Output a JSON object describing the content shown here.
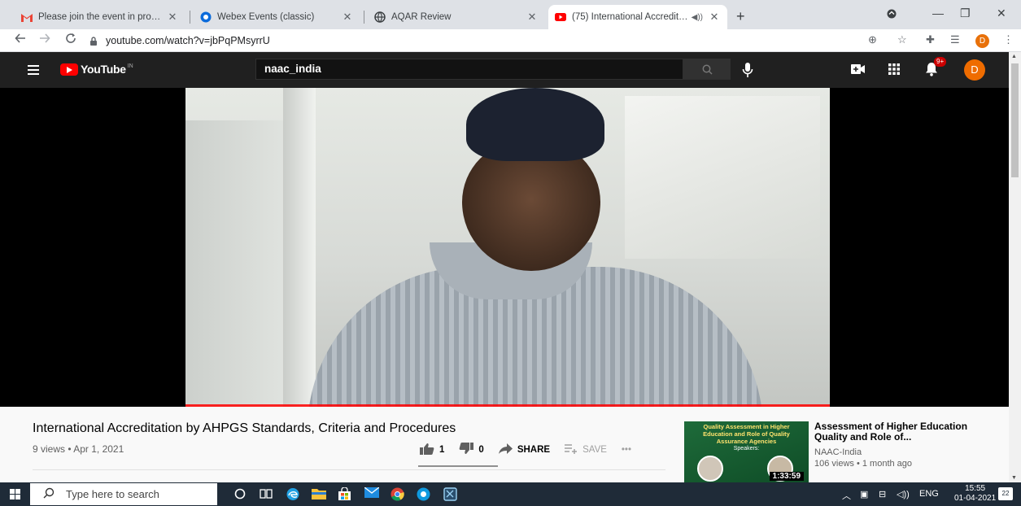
{
  "browser": {
    "tabs": [
      {
        "title": "Please join the event in progress",
        "favicon": "gmail-icon",
        "active": false
      },
      {
        "title": "Webex Events (classic)",
        "favicon": "webex-icon",
        "active": false
      },
      {
        "title": "AQAR Review",
        "favicon": "globe-icon",
        "active": false
      },
      {
        "title": "(75) International Accreditati",
        "favicon": "youtube-icon",
        "active": true
      }
    ],
    "tab_close": "✕",
    "new_tab": "+",
    "window_controls": [
      "—",
      "❐",
      "✕"
    ],
    "url": "youtube.com/watch?v=jbPqPMsyrrU",
    "profile_initial": "D"
  },
  "youtube": {
    "logo_text": "YouTube",
    "logo_country": "IN",
    "search_value": "naac_india",
    "notification_count": "9+",
    "avatar_initial": "D"
  },
  "video": {
    "title": "International Accreditation by AHPGS Standards, Criteria and Procedures",
    "meta": "9 views • Apr 1, 2021",
    "likes": "1",
    "dislikes": "0",
    "share_label": "SHARE",
    "save_label": "SAVE",
    "more_label": "•••"
  },
  "recommendation": {
    "thumb_line1": "Quality Assessment in Higher",
    "thumb_line2": "Education and Role of Quality",
    "thumb_line3": "Assurance Agencies",
    "thumb_speakers": "Speakers:",
    "duration": "1:33:59",
    "title": "Assessment of Higher Education Quality and Role of...",
    "channel": "NAAC-India",
    "views": "106 views • 1 month ago"
  },
  "taskbar": {
    "search_placeholder": "Type here to search",
    "lang": "ENG",
    "time": "15:55",
    "date": "01-04-2021",
    "notification_count": "22"
  },
  "colors": {
    "youtube_red": "#ff0000",
    "header_bg": "#202020",
    "taskbar_bg": "#1f2b38",
    "avatar_orange": "#ef6c00"
  }
}
